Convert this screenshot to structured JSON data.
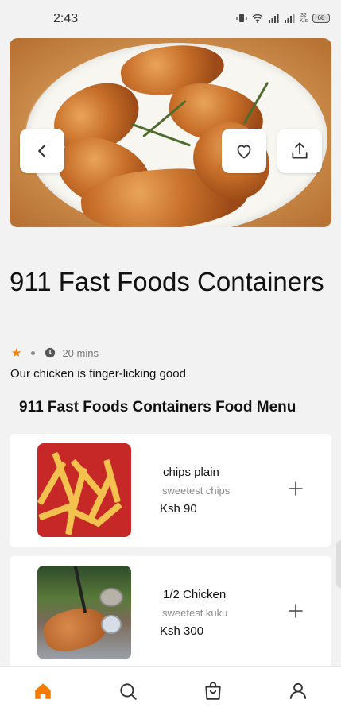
{
  "status_bar": {
    "time": "2:43",
    "net_speed": "32",
    "net_unit": "K/s",
    "battery": "68"
  },
  "hero": {
    "image": "roast-chicken-wings-photo",
    "back_icon": "chevron-left-icon",
    "favorite_icon": "heart-icon",
    "share_icon": "share-icon"
  },
  "restaurant": {
    "name": "911 Fast Foods Containers",
    "rating_icon": "star-icon",
    "delivery_time": "20 mins",
    "tagline": "Our chicken is finger-licking good",
    "menu_heading": "911 Fast Foods Containers Food Menu"
  },
  "menu": {
    "items": [
      {
        "name": "chips plain",
        "description": "sweetest chips",
        "price": "Ksh 90",
        "image": "fries-photo"
      },
      {
        "name": "1/2 Chicken",
        "description": "sweetest kuku",
        "price": "Ksh 300",
        "image": "chicken-photo"
      }
    ]
  },
  "bottom_nav": {
    "tabs": [
      "home",
      "search",
      "cart",
      "profile"
    ],
    "active": "home"
  },
  "colors": {
    "accent": "#f57c00",
    "background": "#f2f2f2",
    "card": "#ffffff",
    "muted_text": "#888888"
  }
}
